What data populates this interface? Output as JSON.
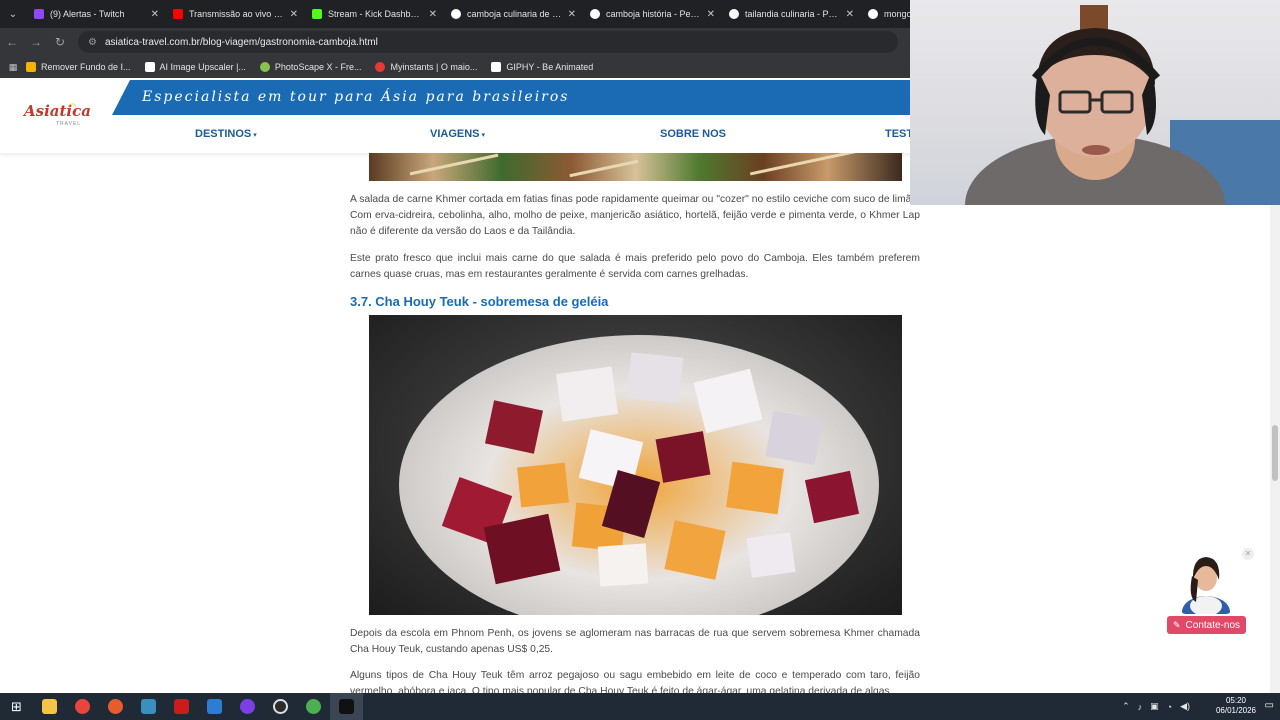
{
  "browser": {
    "tabs": [
      {
        "title": "(9) Alertas - Twitch",
        "color": "#9146ff"
      },
      {
        "title": "Transmissão ao vivo - YouTube",
        "color": "#ff0000"
      },
      {
        "title": "Stream - Kick Dashboard",
        "color": "#53fc18"
      },
      {
        "title": "camboja culinaria de capital",
        "color": "#4285f4"
      },
      {
        "title": "camboja história - Pesquisa",
        "color": "#4285f4"
      },
      {
        "title": "tailandia culinaria - Pesquisa",
        "color": "#4285f4"
      },
      {
        "title": "mongolia",
        "color": "#4285f4"
      }
    ],
    "url": "asiatica-travel.com.br/blog-viagem/gastronomia-camboja.html",
    "bookmarks": [
      {
        "label": "Remover Fundo de I...",
        "color": "#f4b400"
      },
      {
        "label": "AI Image Upscaler |...",
        "color": "#ffffff"
      },
      {
        "label": "PhotoScape X - Fre...",
        "color": "#8bc34a"
      },
      {
        "label": "Myinstants | O maio...",
        "color": "#e53935"
      },
      {
        "label": "GIPHY - Be Animated",
        "color": "#ffffff"
      }
    ]
  },
  "site": {
    "logo_text": "Asiatica",
    "logo_sub": "TRAVEL",
    "tagline": "Especialista em tour para Ásia para brasileiros",
    "nav": {
      "destinos": "DESTINOS",
      "viagens": "VIAGENS",
      "sobre": "SOBRE NOS",
      "testemunhos": "TEST"
    },
    "accent": "#1a6bb3"
  },
  "article": {
    "para1": "A salada de carne Khmer cortada em fatias finas pode rapidamente queimar ou \"cozer\" no estilo ceviche com suco de limão. Com erva-cidreira, cebolinha, alho, molho de peixe, manjericão asiático, hortelã, feijão verde e pimenta verde, o Khmer Lap não é diferente da versão do Laos e da Tailândia.",
    "para2": "Este prato fresco que inclui mais carne do que salada é mais preferido pelo povo do Camboja. Eles também preferem carnes quase cruas, mas em restaurantes geralmente é servida com carnes grelhadas.",
    "heading": "3.7. Cha Houy Teuk - sobremesa de geléia",
    "para3": "Depois da escola em Phnom Penh, os jovens se aglomeram nas barracas de rua que servem sobremesa Khmer chamada Cha Houy Teuk, custando apenas US$ 0,25.",
    "para4": "Alguns tipos de Cha Houy Teuk têm arroz pegajoso ou sagu embebido em leite de coco e temperado com taro, feijão vermelho, abóbora e jaca. O tipo mais popular de Cha Houy Teuk é feito de ágar-ágar, uma gelatina derivada de algas"
  },
  "widget": {
    "contact_label": "Contate-nos"
  },
  "taskbar": {
    "time": "05:20",
    "date": "06/01/2026"
  }
}
